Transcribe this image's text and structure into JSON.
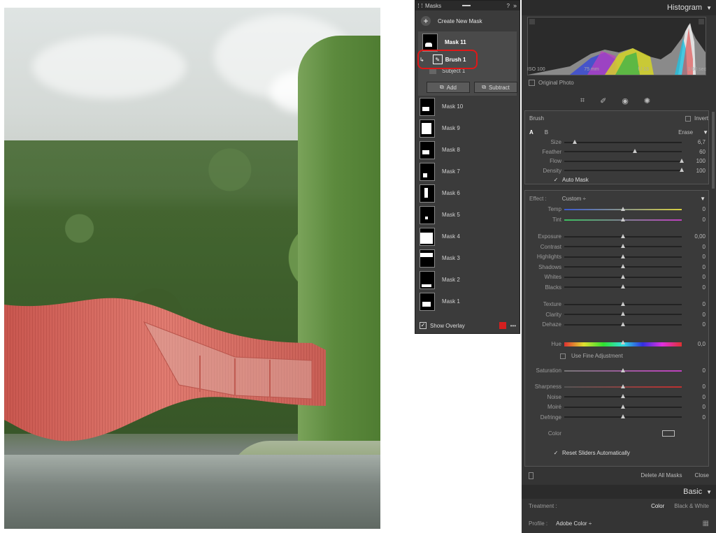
{
  "masks_panel": {
    "title": "Masks",
    "create_label": "Create New Mask",
    "selected_mask": "Mask 11",
    "brush_label": "Brush 1",
    "subject_label": "Subject 1",
    "add_label": "Add",
    "subtract_label": "Subtract",
    "masks": [
      "Mask 10",
      "Mask 9",
      "Mask 8",
      "Mask 7",
      "Mask 6",
      "Mask 5",
      "Mask 4",
      "Mask 3",
      "Mask 2",
      "Mask 1"
    ],
    "show_overlay_label": "Show Overlay",
    "overlay_color": "#d41f1f",
    "help_icon": "?",
    "collapse_icon": "»",
    "more_icon": "•••"
  },
  "histogram": {
    "title": "Histogram",
    "iso": "ISO 100",
    "focal": "75 mm",
    "aperture": "f / 13",
    "shutter": "1/60 sec",
    "original_photo": "Original Photo"
  },
  "brush": {
    "title": "Brush",
    "invert": "Invert",
    "a": "A",
    "b": "B",
    "erase": "Erase",
    "sliders": [
      {
        "label": "Size",
        "value": "6,7",
        "pos": 0.09
      },
      {
        "label": "Feather",
        "value": "60",
        "pos": 0.6
      },
      {
        "label": "Flow",
        "value": "100",
        "pos": 1.0
      },
      {
        "label": "Density",
        "value": "100",
        "pos": 1.0
      }
    ],
    "auto_mask": "Auto Mask"
  },
  "effect": {
    "label": "Effect :",
    "preset": "Custom",
    "temp": {
      "label": "Temp",
      "value": "0"
    },
    "tint": {
      "label": "Tint",
      "value": "0"
    },
    "group1": [
      {
        "label": "Exposure",
        "value": "0,00"
      },
      {
        "label": "Contrast",
        "value": "0"
      },
      {
        "label": "Highlights",
        "value": "0"
      },
      {
        "label": "Shadows",
        "value": "0"
      },
      {
        "label": "Whites",
        "value": "0"
      },
      {
        "label": "Blacks",
        "value": "0"
      }
    ],
    "group2": [
      {
        "label": "Texture",
        "value": "0"
      },
      {
        "label": "Clarity",
        "value": "0"
      },
      {
        "label": "Dehaze",
        "value": "0"
      }
    ],
    "hue": {
      "label": "Hue",
      "value": "0,0"
    },
    "fine": "Use Fine Adjustment",
    "saturation": {
      "label": "Saturation",
      "value": "0"
    },
    "group3": [
      {
        "label": "Sharpness",
        "value": "0"
      },
      {
        "label": "Noise",
        "value": "0"
      },
      {
        "label": "Moiré",
        "value": "0"
      },
      {
        "label": "Defringe",
        "value": "0"
      }
    ],
    "color_label": "Color",
    "reset": "Reset Sliders Automatically"
  },
  "footer": {
    "delete_all": "Delete All Masks",
    "close": "Close"
  },
  "basic": {
    "title": "Basic",
    "treatment": "Treatment :",
    "color": "Color",
    "bw": "Black & White",
    "profile": "Profile :",
    "profile_value": "Adobe Color"
  }
}
